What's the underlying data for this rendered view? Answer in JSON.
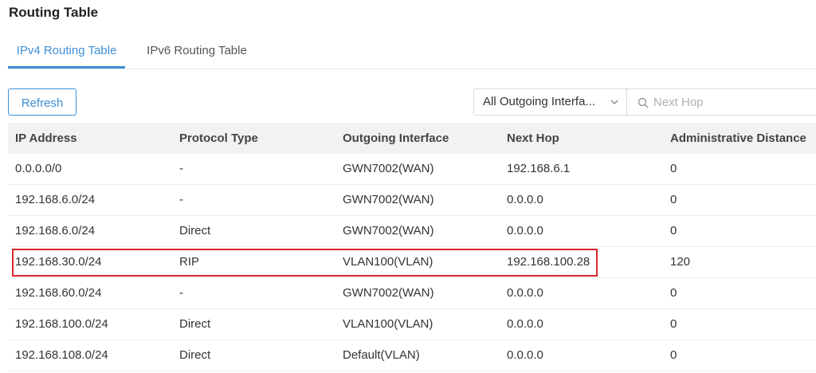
{
  "page": {
    "title": "Routing Table"
  },
  "tabs": [
    {
      "label": "IPv4 Routing Table",
      "active": true
    },
    {
      "label": "IPv6 Routing Table",
      "active": false
    }
  ],
  "toolbar": {
    "refresh_label": "Refresh",
    "interface_filter": {
      "selected": "All Outgoing Interfa...",
      "icon": "chevron-down-icon"
    },
    "search": {
      "placeholder": "Next Hop",
      "value": "",
      "icon": "search-icon"
    }
  },
  "table": {
    "columns": [
      "IP Address",
      "Protocol Type",
      "Outgoing Interface",
      "Next Hop",
      "Administrative Distance"
    ],
    "rows": [
      [
        "0.0.0.0/0",
        "-",
        "GWN7002(WAN)",
        "192.168.6.1",
        "0"
      ],
      [
        "192.168.6.0/24",
        "-",
        "GWN7002(WAN)",
        "0.0.0.0",
        "0"
      ],
      [
        "192.168.6.0/24",
        "Direct",
        "GWN7002(WAN)",
        "0.0.0.0",
        "0"
      ],
      [
        "192.168.30.0/24",
        "RIP",
        "VLAN100(VLAN)",
        "192.168.100.28",
        "120"
      ],
      [
        "192.168.60.0/24",
        "-",
        "GWN7002(WAN)",
        "0.0.0.0",
        "0"
      ],
      [
        "192.168.100.0/24",
        "Direct",
        "VLAN100(VLAN)",
        "0.0.0.0",
        "0"
      ],
      [
        "192.168.108.0/24",
        "Direct",
        "Default(VLAN)",
        "0.0.0.0",
        "0"
      ]
    ],
    "highlighted_row": 3
  },
  "colors": {
    "accent": "#3d8fd6",
    "highlight": "#d9262c",
    "header_bg": "#f2f2f2"
  }
}
